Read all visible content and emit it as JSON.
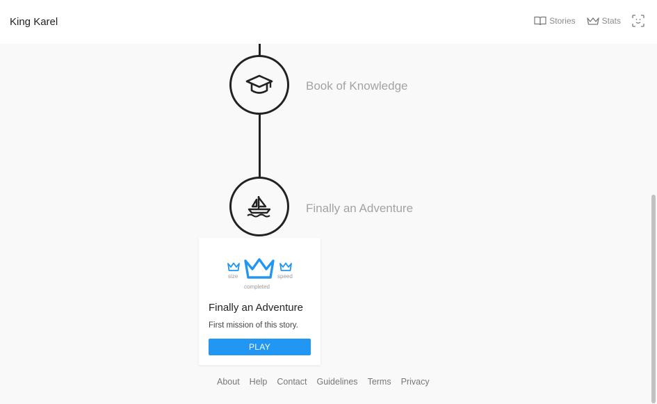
{
  "header": {
    "title": "King Karel",
    "nav": [
      {
        "label": "Stories",
        "icon": "book-icon"
      },
      {
        "label": "Stats",
        "icon": "crown-icon"
      },
      {
        "label": "",
        "icon": "scan-face-icon"
      }
    ]
  },
  "path": {
    "nodes": [
      {
        "label": "Book of Knowledge",
        "icon": "graduation-cap-icon"
      },
      {
        "label": "Finally an Adventure",
        "icon": "sailboat-icon"
      }
    ]
  },
  "mission_card": {
    "crown_labels": {
      "left": "size",
      "right": "speed",
      "center": "completed"
    },
    "crown_color": "#2196f3",
    "title": "Finally an Adventure",
    "description": "First mission of this story.",
    "play_label": "PLAY"
  },
  "footer": {
    "links": [
      "About",
      "Help",
      "Contact",
      "Guidelines",
      "Terms",
      "Privacy"
    ]
  },
  "colors": {
    "accent": "#2196f3",
    "node_border": "#222222",
    "muted_text": "#a3a3a3"
  }
}
